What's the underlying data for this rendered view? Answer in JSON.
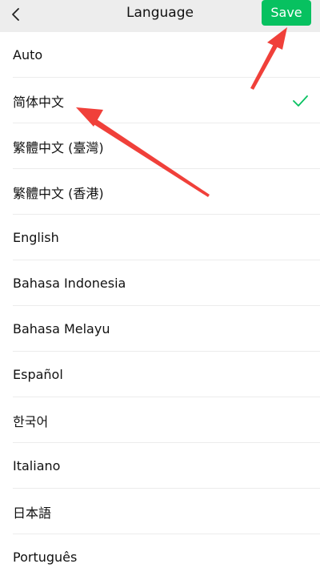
{
  "header": {
    "title": "Language",
    "save_label": "Save",
    "back_icon": "chevron-left-icon"
  },
  "colors": {
    "accent": "#07c160",
    "header_bg": "#ededed",
    "annotation": "#f0403a"
  },
  "languages": [
    {
      "label": "Auto",
      "selected": false
    },
    {
      "label": "简体中文",
      "selected": true
    },
    {
      "label": "繁體中文 (臺灣)",
      "selected": false
    },
    {
      "label": "繁體中文 (香港)",
      "selected": false
    },
    {
      "label": "English",
      "selected": false
    },
    {
      "label": "Bahasa Indonesia",
      "selected": false
    },
    {
      "label": "Bahasa Melayu",
      "selected": false
    },
    {
      "label": "Español",
      "selected": false
    },
    {
      "label": "한국어",
      "selected": false
    },
    {
      "label": "Italiano",
      "selected": false
    },
    {
      "label": "日本語",
      "selected": false
    },
    {
      "label": "Português",
      "selected": false
    }
  ]
}
